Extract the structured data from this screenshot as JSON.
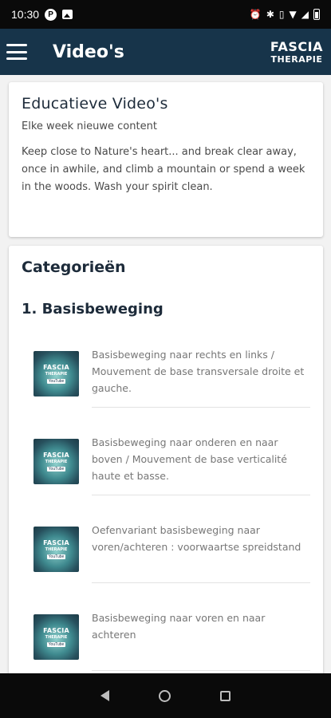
{
  "status_bar": {
    "time": "10:30",
    "icons_left": [
      "p-badge-icon",
      "image-icon"
    ],
    "icons_right": [
      "alarm-icon",
      "bluetooth-icon",
      "vibrate-icon",
      "wifi-icon",
      "signal-icon",
      "battery-icon"
    ]
  },
  "app_bar": {
    "title": "Video's",
    "brand_line1": "FASCIA",
    "brand_line2": "THERAPIE",
    "background": "#17344a"
  },
  "intro": {
    "title": "Educatieve Video's",
    "subtitle": "Elke week nieuwe content",
    "body": "Keep close to Nature's heart... and break clear away, once in awhile, and climb a mountain or spend a week in the woods. Wash your spirit clean."
  },
  "categories": {
    "title": "Categorieën",
    "section_title": "1. Basisbeweging",
    "thumb_line1": "FASCIA",
    "thumb_line2": "THERAPIE",
    "thumb_badge": "YouTube",
    "videos": [
      {
        "title": "Basisbeweging naar rechts en links / Mouvement de base transversale droite et gauche."
      },
      {
        "title": "Basisbeweging naar onderen en naar boven / Mouvement de base verticalité haute et basse."
      },
      {
        "title": "Oefenvariant basisbeweging naar voren/achteren : voorwaartse spreidstand"
      },
      {
        "title": "Basisbeweging naar voren en naar achteren"
      }
    ]
  },
  "nav_bar": {
    "buttons": [
      "back-icon",
      "home-icon",
      "recents-icon"
    ]
  }
}
